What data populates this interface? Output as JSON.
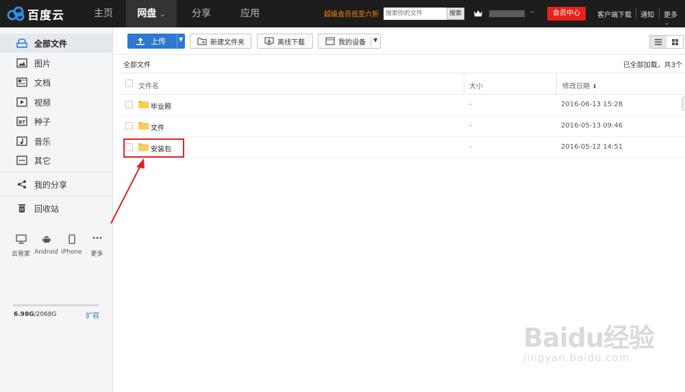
{
  "header": {
    "logo_text": "百度云",
    "nav": [
      {
        "label": "主页",
        "active": false
      },
      {
        "label": "网盘",
        "active": true,
        "caret": "⌄"
      },
      {
        "label": "分享",
        "active": false
      },
      {
        "label": "应用",
        "active": false
      }
    ],
    "promo": "超级会员低至六折",
    "search_placeholder": "搜索你的文件",
    "search_button": "搜索",
    "user_caret": "⌄",
    "vip_center": "会员中心",
    "links": [
      "客户端下载",
      "通知",
      "更多"
    ],
    "more_caret": "⌄"
  },
  "sidebar": {
    "items": [
      {
        "label": "全部文件",
        "icon": "cloud-drive-icon",
        "active": true
      },
      {
        "label": "图片",
        "icon": "image-icon"
      },
      {
        "label": "文档",
        "icon": "document-icon"
      },
      {
        "label": "视频",
        "icon": "video-icon"
      },
      {
        "label": "种子",
        "icon": "bt-icon"
      },
      {
        "label": "音乐",
        "icon": "music-icon"
      },
      {
        "label": "其它",
        "icon": "other-icon"
      }
    ],
    "share": "我的分享",
    "trash": "回收站",
    "devices": [
      {
        "label": "云管家",
        "icon": "monitor-icon"
      },
      {
        "label": "Android",
        "icon": "android-icon"
      },
      {
        "label": "iPhone",
        "icon": "phone-icon"
      },
      {
        "label": "更多",
        "icon": "more-icon"
      }
    ],
    "quota_used": "6.98G",
    "quota_total": "/2068G",
    "quota_fraction": 0.0034,
    "expand": "扩容"
  },
  "toolbar": {
    "upload": "上传",
    "new_folder": "新建文件夹",
    "offline_download": "离线下载",
    "my_devices": "我的设备"
  },
  "content": {
    "breadcrumb": "全部文件",
    "loaded_status": "已全部加载，共3个",
    "columns": {
      "name": "文件名",
      "size": "大小",
      "date": "修改日期",
      "sort_arrow": "⬇"
    },
    "files": [
      {
        "name": "毕业照",
        "size": "-",
        "date": "2016-06-13 15:28"
      },
      {
        "name": "文件",
        "size": "-",
        "date": "2016-05-13 09:46"
      },
      {
        "name": "安装包",
        "size": "-",
        "date": "2016-05-12 14:51"
      }
    ]
  },
  "watermark": {
    "main": "Baidu经验",
    "sub": "jingyan.baidu.com"
  },
  "colors": {
    "topbar": "#1d1d1d",
    "accent": "#2f77d0",
    "vip": "#e8211b",
    "promo": "#ff8a00",
    "highlight": "#e0202a",
    "folder": "#f5c343"
  }
}
